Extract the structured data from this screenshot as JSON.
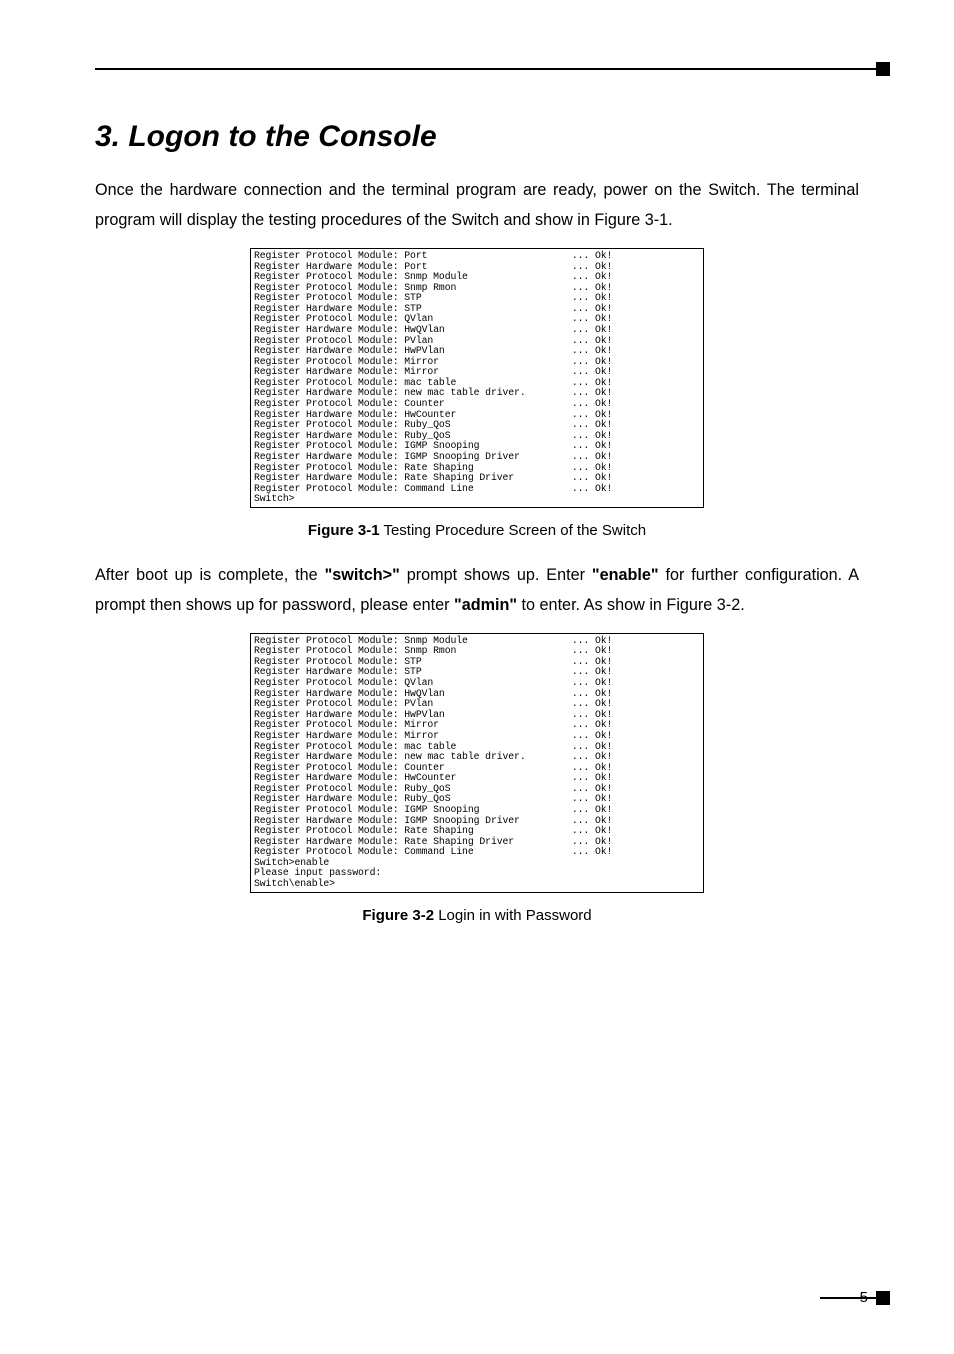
{
  "accent": {
    "color": "#000000"
  },
  "heading": "3. Logon to the Console",
  "para1": "Once the hardware connection and the terminal program are ready, power on the Switch. The terminal program will display the testing procedures of the Switch and show in Figure 3-1.",
  "terminal1": {
    "lines": [
      {
        "label": "Register Protocol Module:",
        "name": "Port",
        "status": "Ok!"
      },
      {
        "label": "Register Hardware Module:",
        "name": "Port",
        "status": "Ok!"
      },
      {
        "label": "Register Protocol Module:",
        "name": "Snmp Module",
        "status": "Ok!"
      },
      {
        "label": "Register Protocol Module:",
        "name": "Snmp Rmon",
        "status": "Ok!"
      },
      {
        "label": "Register Protocol Module:",
        "name": "STP",
        "status": "Ok!"
      },
      {
        "label": "Register Hardware Module:",
        "name": "STP",
        "status": "Ok!"
      },
      {
        "label": "Register Protocol Module:",
        "name": "QVlan",
        "status": "Ok!"
      },
      {
        "label": "Register Hardware Module:",
        "name": "HwQVlan",
        "status": "Ok!"
      },
      {
        "label": "Register Protocol Module:",
        "name": "PVlan",
        "status": "Ok!"
      },
      {
        "label": "Register Hardware Module:",
        "name": "HwPVlan",
        "status": "Ok!"
      },
      {
        "label": "Register Protocol Module:",
        "name": "Mirror",
        "status": "Ok!"
      },
      {
        "label": "Register Hardware Module:",
        "name": "Mirror",
        "status": "Ok!"
      },
      {
        "label": "Register Protocol Module:",
        "name": "mac table",
        "status": "Ok!"
      },
      {
        "label": "Register Hardware Module:",
        "name": "new mac table driver.",
        "status": "Ok!"
      },
      {
        "label": "Register Protocol Module:",
        "name": "Counter",
        "status": "Ok!"
      },
      {
        "label": "Register Hardware Module:",
        "name": "HwCounter",
        "status": "Ok!"
      },
      {
        "label": "Register Protocol Module:",
        "name": "Ruby_QoS",
        "status": "Ok!"
      },
      {
        "label": "Register Hardware Module:",
        "name": "Ruby_QoS",
        "status": "Ok!"
      },
      {
        "label": "Register Protocol Module:",
        "name": "IGMP Snooping",
        "status": "Ok!"
      },
      {
        "label": "Register Hardware Module:",
        "name": "IGMP Snooping Driver",
        "status": "Ok!"
      },
      {
        "label": "Register Protocol Module:",
        "name": "Rate Shaping",
        "status": "Ok!"
      },
      {
        "label": "Register Hardware Module:",
        "name": "Rate Shaping Driver",
        "status": "Ok!"
      },
      {
        "label": "Register Protocol Module:",
        "name": "Command Line",
        "status": "Ok!"
      }
    ],
    "tail": [
      "Switch>"
    ]
  },
  "caption1": {
    "label": "Figure 3-1",
    "text": "  Testing Procedure Screen of the Switch"
  },
  "para2_parts": {
    "a": "After boot up is complete, the ",
    "b": "\"switch>\"",
    "c": " prompt shows up. Enter ",
    "d": "\"enable\"",
    "e": " for further configuration. A prompt then shows up for password, please enter ",
    "f": "\"admin\"",
    "g": " to enter. As show in Figure 3-2."
  },
  "terminal2": {
    "lines": [
      {
        "label": "Register Protocol Module:",
        "name": "Snmp Module",
        "status": "Ok!"
      },
      {
        "label": "Register Protocol Module:",
        "name": "Snmp Rmon",
        "status": "Ok!"
      },
      {
        "label": "Register Protocol Module:",
        "name": "STP",
        "status": "Ok!"
      },
      {
        "label": "Register Hardware Module:",
        "name": "STP",
        "status": "Ok!"
      },
      {
        "label": "Register Protocol Module:",
        "name": "QVlan",
        "status": "Ok!"
      },
      {
        "label": "Register Hardware Module:",
        "name": "HwQVlan",
        "status": "Ok!"
      },
      {
        "label": "Register Protocol Module:",
        "name": "PVlan",
        "status": "Ok!"
      },
      {
        "label": "Register Hardware Module:",
        "name": "HwPVlan",
        "status": "Ok!"
      },
      {
        "label": "Register Protocol Module:",
        "name": "Mirror",
        "status": "Ok!"
      },
      {
        "label": "Register Hardware Module:",
        "name": "Mirror",
        "status": "Ok!"
      },
      {
        "label": "Register Protocol Module:",
        "name": "mac table",
        "status": "Ok!"
      },
      {
        "label": "Register Hardware Module:",
        "name": "new mac table driver.",
        "status": "Ok!"
      },
      {
        "label": "Register Protocol Module:",
        "name": "Counter",
        "status": "Ok!"
      },
      {
        "label": "Register Hardware Module:",
        "name": "HwCounter",
        "status": "Ok!"
      },
      {
        "label": "Register Protocol Module:",
        "name": "Ruby_QoS",
        "status": "Ok!"
      },
      {
        "label": "Register Hardware Module:",
        "name": "Ruby_QoS",
        "status": "Ok!"
      },
      {
        "label": "Register Protocol Module:",
        "name": "IGMP Snooping",
        "status": "Ok!"
      },
      {
        "label": "Register Hardware Module:",
        "name": "IGMP Snooping Driver",
        "status": "Ok!"
      },
      {
        "label": "Register Protocol Module:",
        "name": "Rate Shaping",
        "status": "Ok!"
      },
      {
        "label": "Register Hardware Module:",
        "name": "Rate Shaping Driver",
        "status": "Ok!"
      },
      {
        "label": "Register Protocol Module:",
        "name": "Command Line",
        "status": "Ok!"
      }
    ],
    "tail": [
      "Switch>enable",
      "Please input password:",
      "Switch\\enable>"
    ]
  },
  "caption2": {
    "label": "Figure 3-2",
    "text": "  Login in with Password"
  },
  "page_number": "5"
}
